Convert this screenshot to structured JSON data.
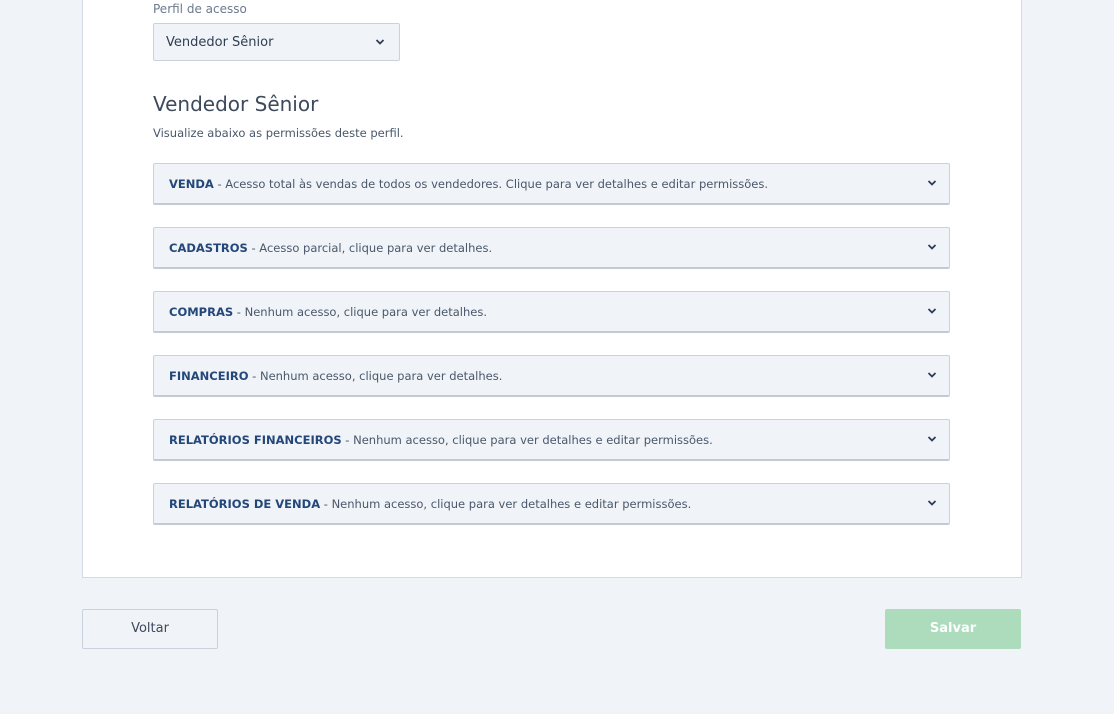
{
  "profile_field": {
    "label": "Perfil de acesso",
    "selected": "Vendedor Sênior"
  },
  "profile": {
    "title": "Vendedor Sênior",
    "subtitle": "Visualize abaixo as permissões deste perfil."
  },
  "permissions": [
    {
      "name": "VENDA",
      "description": " - Acesso total às vendas de todos os vendedores. Clique para ver detalhes e editar permissões."
    },
    {
      "name": "CADASTROS",
      "description": " - Acesso parcial, clique para ver detalhes."
    },
    {
      "name": "COMPRAS",
      "description": " - Nenhum acesso, clique para ver detalhes."
    },
    {
      "name": "FINANCEIRO",
      "description": " - Nenhum acesso, clique para ver detalhes."
    },
    {
      "name": "RELATÓRIOS FINANCEIROS",
      "description": " - Nenhum acesso, clique para ver detalhes e editar permissões."
    },
    {
      "name": "RELATÓRIOS DE VENDA",
      "description": " - Nenhum acesso, clique para ver detalhes e editar permissões."
    }
  ],
  "actions": {
    "back_label": "Voltar",
    "save_label": "Salvar"
  },
  "icons": {
    "dropdown": "chevron-down-icon"
  },
  "colors": {
    "accent_text": "#24477a",
    "save_button": "#addcbd",
    "page_background": "#f0f3f7"
  }
}
